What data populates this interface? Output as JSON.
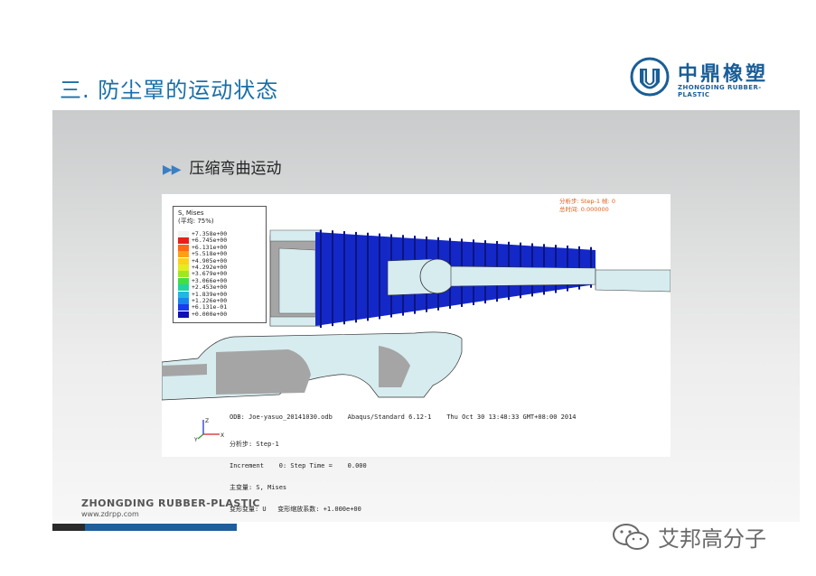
{
  "slide": {
    "title": "三. 防尘罩的运动状态",
    "subtitle_arrows": "▶▶",
    "subtitle": "压缩弯曲运动",
    "logo": {
      "cn": "中鼎橡塑",
      "en": "ZHONGDING RUBBER-PLASTIC"
    },
    "footer": {
      "brand": "ZHONGDING RUBBER-PLASTIC",
      "url": "www.zdrpp.com"
    },
    "watermark": "艾邦高分子",
    "colors": {
      "title": "#1a6fa8",
      "brand": "#1a5e97",
      "footer_bar": "#1f5e9a",
      "boot": "#1428c8"
    }
  },
  "simulation": {
    "legend_header": [
      "S, Mises",
      "(平均: 75%)"
    ],
    "legend_values": [
      "+7.358e+00",
      "+6.745e+00",
      "+6.131e+00",
      "+5.518e+00",
      "+4.905e+00",
      "+4.292e+00",
      "+3.679e+00",
      "+3.066e+00",
      "+2.453e+00",
      "+1.839e+00",
      "+1.226e+00",
      "+6.131e-01",
      "+0.000e+00"
    ],
    "legend_colors": [
      "#f2f2f2",
      "#e8201a",
      "#ff6a10",
      "#ffa010",
      "#ffd21a",
      "#dfef20",
      "#9fe820",
      "#40e040",
      "#20d4a0",
      "#20b8e0",
      "#1a86ec",
      "#1a3aee",
      "#1010b4"
    ],
    "step_info": [
      "分析步: Step-1  帧: 0",
      "总时间: 0.000000"
    ],
    "odb_line": "ODB: Joe-yasuo_20141030.odb    Abaqus/Standard 6.12-1    Thu Oct 30 13:48:33 GMT+08:00 2014",
    "step_lines": [
      "分析步: Step-1",
      "Increment    0: Step Time =    0.000",
      "主变量: S, Mises",
      "变形变量: U   变形缩放系数: +1.000e+00"
    ],
    "triad_labels": [
      "Z",
      "X",
      "Y"
    ]
  }
}
